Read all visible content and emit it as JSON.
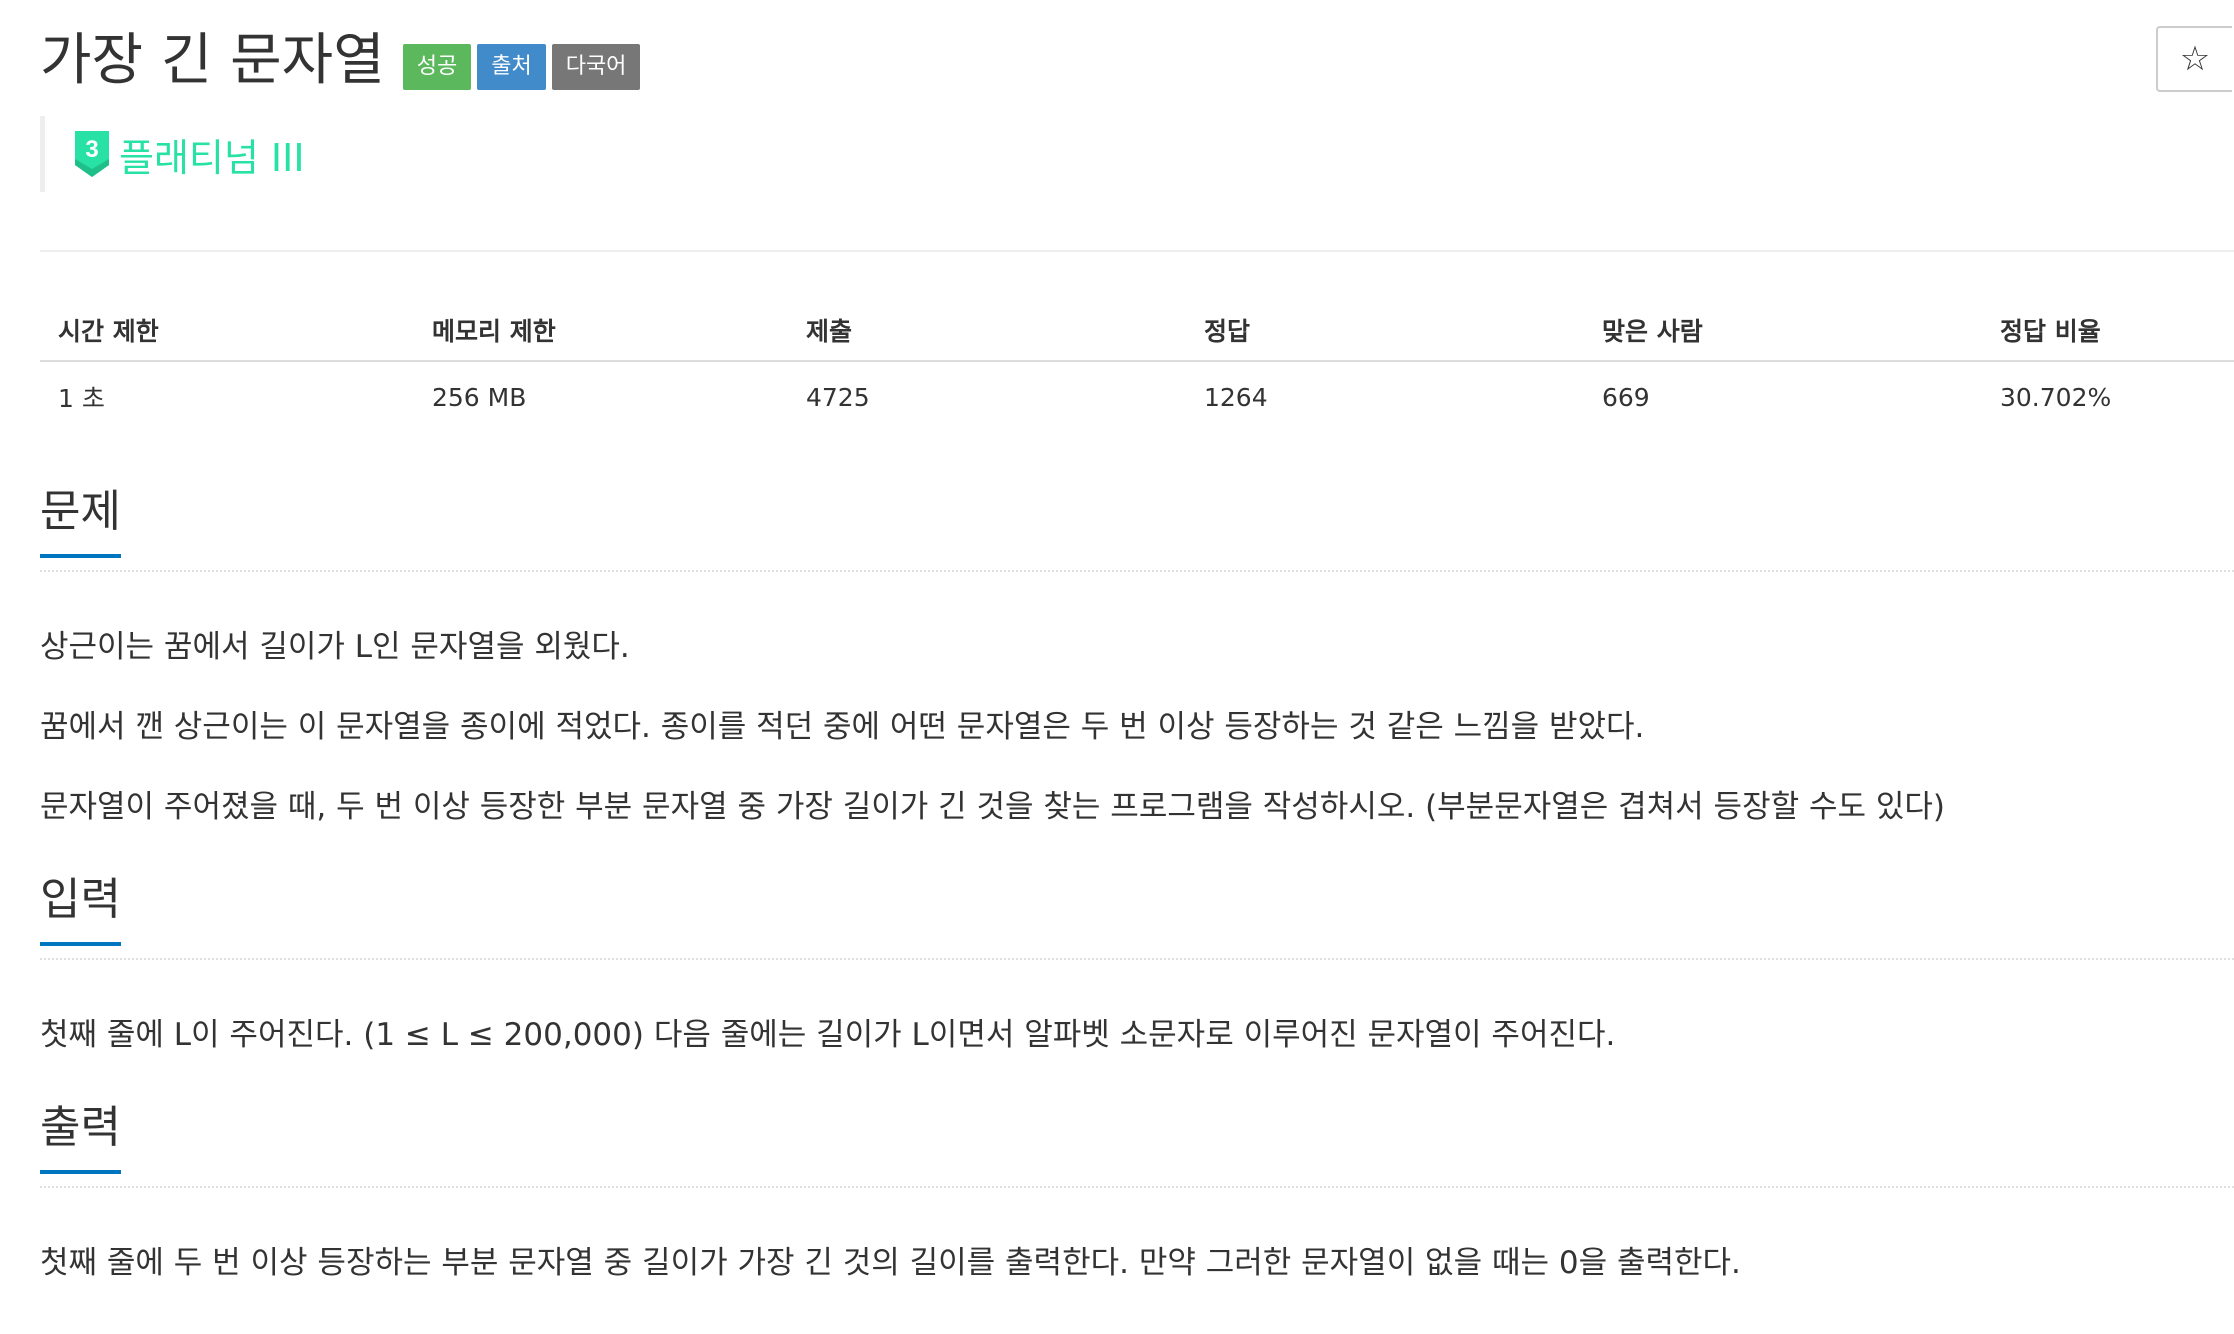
{
  "problem": {
    "title": "가장 긴 문자열",
    "labels": [
      {
        "text": "성공",
        "color": "#5cb85c"
      },
      {
        "text": "출처",
        "color": "#428bca"
      },
      {
        "text": "다국어",
        "color": "#777777"
      }
    ],
    "tier": {
      "badge_number": "3",
      "text": "플래티넘 III",
      "color": "#27e2a4"
    },
    "star_icon": "☆"
  },
  "stats": {
    "headers": [
      "시간 제한",
      "메모리 제한",
      "제출",
      "정답",
      "맞은 사람",
      "정답 비율"
    ],
    "values": [
      "1 초",
      "256 MB",
      "4725",
      "1264",
      "669",
      "30.702%"
    ]
  },
  "sections": {
    "problem": {
      "heading": "문제",
      "paragraphs": [
        "상근이는 꿈에서 길이가 L인 문자열을 외웠다.",
        "꿈에서 깬 상근이는 이 문자열을 종이에 적었다. 종이를 적던 중에 어떤 문자열은 두 번 이상 등장하는 것 같은 느낌을 받았다.",
        "문자열이 주어졌을 때, 두 번 이상 등장한 부분 문자열 중 가장 길이가 긴 것을 찾는 프로그램을 작성하시오. (부분문자열은 겹쳐서 등장할 수도 있다)"
      ]
    },
    "input": {
      "heading": "입력",
      "paragraphs": [
        "첫째 줄에 L이 주어진다. (1 ≤ L ≤ 200,000) 다음 줄에는 길이가 L이면서 알파벳 소문자로 이루어진 문자열이 주어진다."
      ]
    },
    "output": {
      "heading": "출력",
      "paragraphs": [
        "첫째 줄에 두 번 이상 등장하는 부분 문자열 중 길이가 가장 긴 것의 길이를 출력한다. 만약 그러한 문자열이 없을 때는 0을 출력한다."
      ]
    }
  }
}
